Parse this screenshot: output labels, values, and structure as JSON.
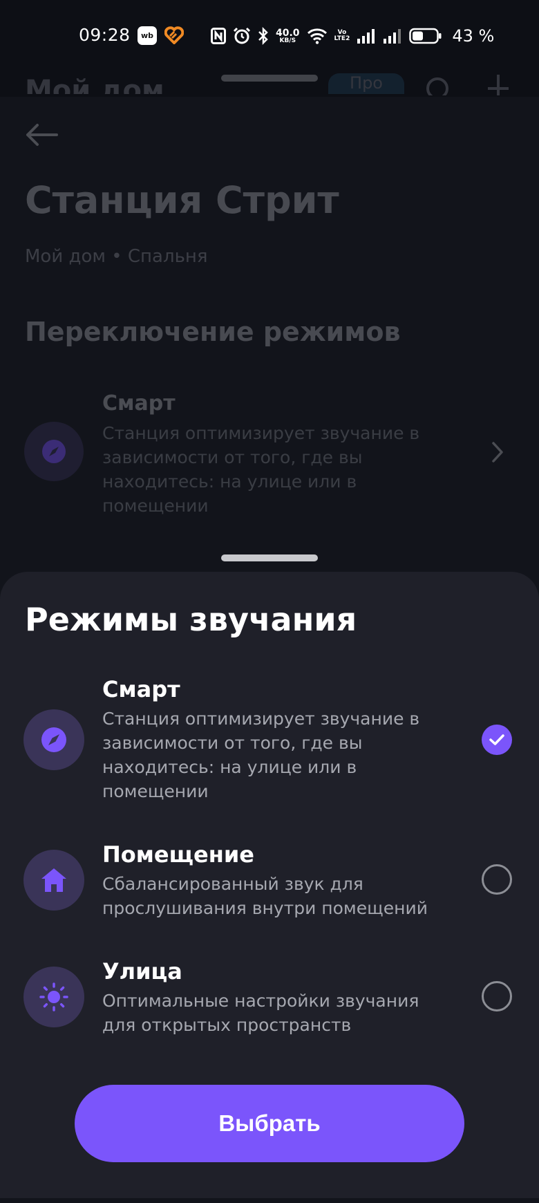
{
  "status_bar": {
    "time": "09:28",
    "wb_label": "wb",
    "net_speed_value": "40.0",
    "net_speed_unit": "KB/S",
    "volte_top": "Vo",
    "volte_bottom": "LTE2",
    "battery_percent": "43 %"
  },
  "background": {
    "top_title": "Мой дом",
    "top_badge": "Про",
    "title": "Станция Стрит",
    "subtitle": "Мой дом • Спальня",
    "section": "Переключение режимов",
    "current_mode": {
      "name": "Смарт",
      "description": "Станция оптимизирует звучание в зависимости от того, где вы находитесь: на улице или в помещении"
    }
  },
  "sheet": {
    "title": "Режимы звучания",
    "modes": [
      {
        "name": "Смарт",
        "description": "Станция оптимизирует звучание в зависимости от того, где вы находитесь: на улице или в помещении",
        "icon": "compass-icon",
        "selected": true
      },
      {
        "name": "Помещение",
        "description": "Сбалансированный звук для прослушивания внутри помещений",
        "icon": "home-icon",
        "selected": false
      },
      {
        "name": "Улица",
        "description": "Оптимальные настройки звучания для открытых пространств",
        "icon": "sun-icon",
        "selected": false
      }
    ],
    "select_label": "Выбрать"
  },
  "colors": {
    "accent": "#7b55fb",
    "sheet_bg": "#1f2029",
    "icon_bg": "#3a3458"
  }
}
